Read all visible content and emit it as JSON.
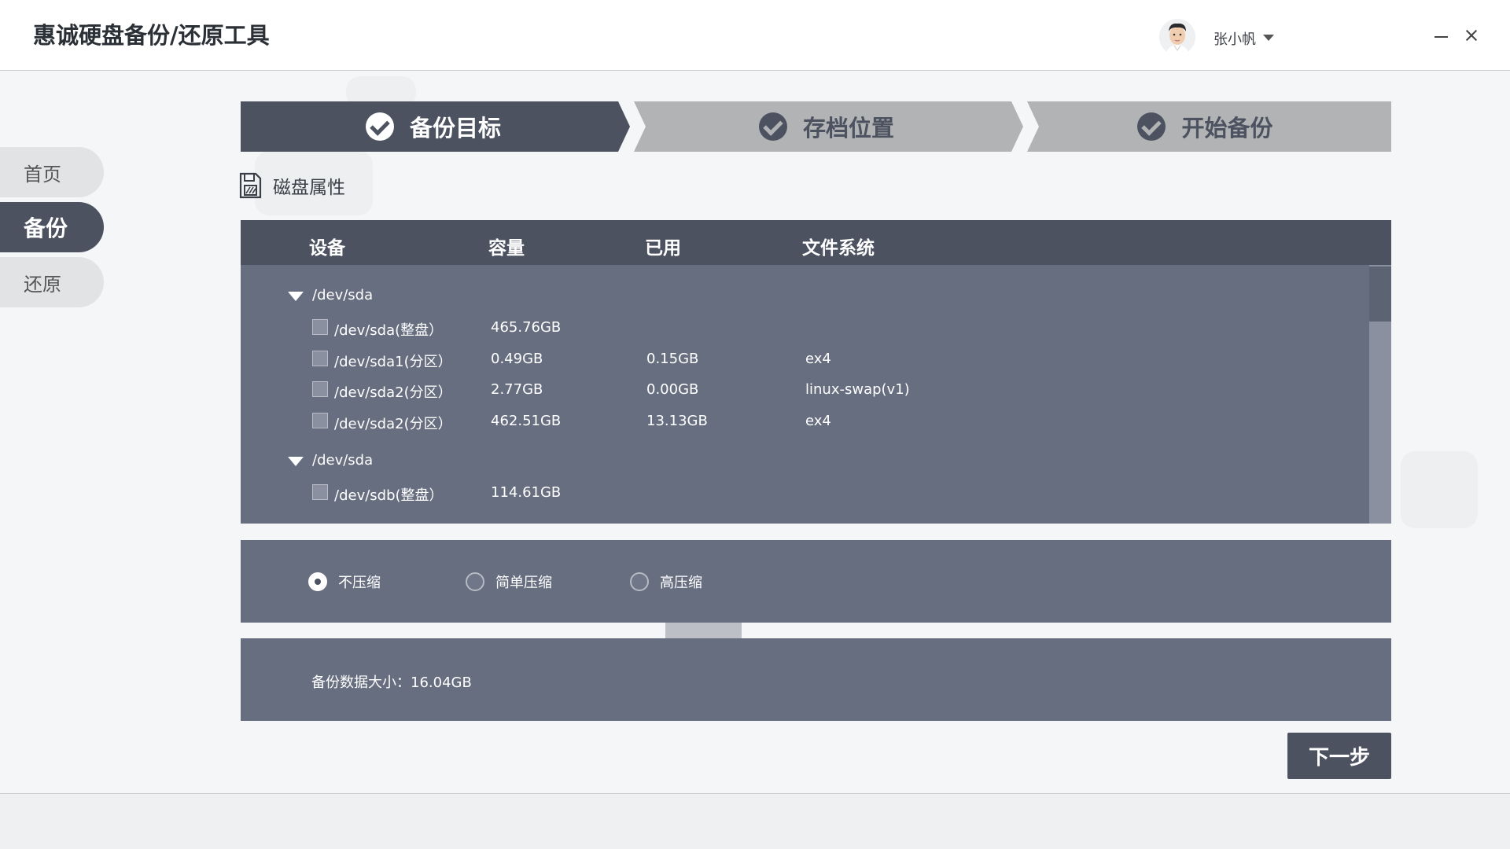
{
  "app": {
    "title": "惠诚硬盘备份/还原工具"
  },
  "user": {
    "name": "张小帆"
  },
  "sidebar": {
    "items": [
      {
        "label": "首页",
        "active": false
      },
      {
        "label": "备份",
        "active": true
      },
      {
        "label": "还原",
        "active": false
      }
    ]
  },
  "stepper": {
    "steps": [
      {
        "label": "备份目标",
        "state": "current"
      },
      {
        "label": "存档位置",
        "state": "pending"
      },
      {
        "label": "开始备份",
        "state": "pending"
      }
    ]
  },
  "section": {
    "label": "磁盘属性"
  },
  "table": {
    "headers": [
      "设备",
      "容量",
      "已用",
      "文件系统"
    ],
    "groups": [
      {
        "name": "/dev/sda",
        "rows": [
          {
            "device": "/dev/sda(整盘）",
            "capacity": "465.76GB",
            "used": "",
            "fs": ""
          },
          {
            "device": "/dev/sda1(分区）",
            "capacity": "0.49GB",
            "used": "0.15GB",
            "fs": "ex4"
          },
          {
            "device": "/dev/sda2(分区）",
            "capacity": "2.77GB",
            "used": "0.00GB",
            "fs": "linux-swap(v1)"
          },
          {
            "device": "/dev/sda2(分区）",
            "capacity": "462.51GB",
            "used": "13.13GB",
            "fs": "ex4"
          }
        ]
      },
      {
        "name": "/dev/sda",
        "rows": [
          {
            "device": "/dev/sdb(整盘）",
            "capacity": "114.61GB",
            "used": "",
            "fs": ""
          }
        ]
      }
    ]
  },
  "compression": {
    "options": [
      {
        "label": "不压缩",
        "selected": true
      },
      {
        "label": "简单压缩",
        "selected": false
      },
      {
        "label": "高压缩",
        "selected": false
      }
    ]
  },
  "summary": {
    "size_text": "备份数据大小：16.04GB"
  },
  "actions": {
    "next_label": "下一步"
  },
  "colors": {
    "dark": "#4d5260",
    "panel": "#666e80",
    "step_pending": "#b2b3b5"
  }
}
